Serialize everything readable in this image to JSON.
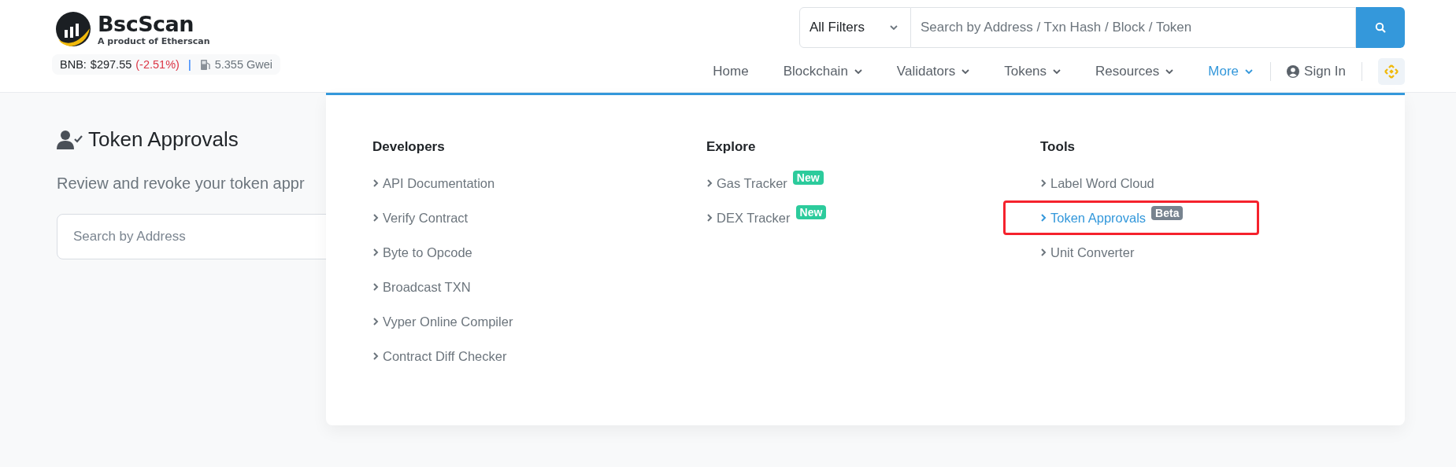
{
  "brand": {
    "name": "BscScan",
    "tagline": "A product of Etherscan"
  },
  "ticker": {
    "label": "BNB:",
    "price": "$297.55",
    "change": "(-2.51%)",
    "falling": true,
    "separator": "|",
    "gas": "5.355 Gwei"
  },
  "search": {
    "filter": "All Filters",
    "placeholder": "Search by Address / Txn Hash / Block / Token"
  },
  "nav": [
    {
      "label": "Home",
      "has_menu": false,
      "selected": false
    },
    {
      "label": "Blockchain",
      "has_menu": true,
      "selected": false
    },
    {
      "label": "Validators",
      "has_menu": true,
      "selected": false
    },
    {
      "label": "Tokens",
      "has_menu": true,
      "selected": false
    },
    {
      "label": "Resources",
      "has_menu": true,
      "selected": false
    },
    {
      "label": "More",
      "has_menu": true,
      "selected": true
    }
  ],
  "sign_in": "Sign In",
  "page": {
    "title": "Token Approvals",
    "subtitle": "Review and revoke your token appr",
    "search_placeholder": "Search by Address"
  },
  "menu": {
    "columns": [
      {
        "heading": "Developers",
        "items": [
          {
            "label": "API Documentation",
            "highlighted": false
          },
          {
            "label": "Verify Contract",
            "highlighted": false
          },
          {
            "label": "Byte to Opcode",
            "highlighted": false
          },
          {
            "label": "Broadcast TXN",
            "highlighted": false
          },
          {
            "label": "Vyper Online Compiler",
            "highlighted": false
          },
          {
            "label": "Contract Diff Checker",
            "highlighted": false
          }
        ]
      },
      {
        "heading": "Explore",
        "items": [
          {
            "label": "Gas Tracker",
            "highlighted": false,
            "badge": {
              "text": "New",
              "kind": "new"
            }
          },
          {
            "label": "DEX Tracker",
            "highlighted": false,
            "badge": {
              "text": "New",
              "kind": "new"
            }
          }
        ]
      },
      {
        "heading": "Tools",
        "items": [
          {
            "label": "Label Word Cloud",
            "highlighted": false
          },
          {
            "label": "Token Approvals",
            "highlighted": true,
            "badge": {
              "text": "Beta",
              "kind": "beta"
            }
          },
          {
            "label": "Unit Converter",
            "highlighted": false
          }
        ]
      }
    ]
  }
}
